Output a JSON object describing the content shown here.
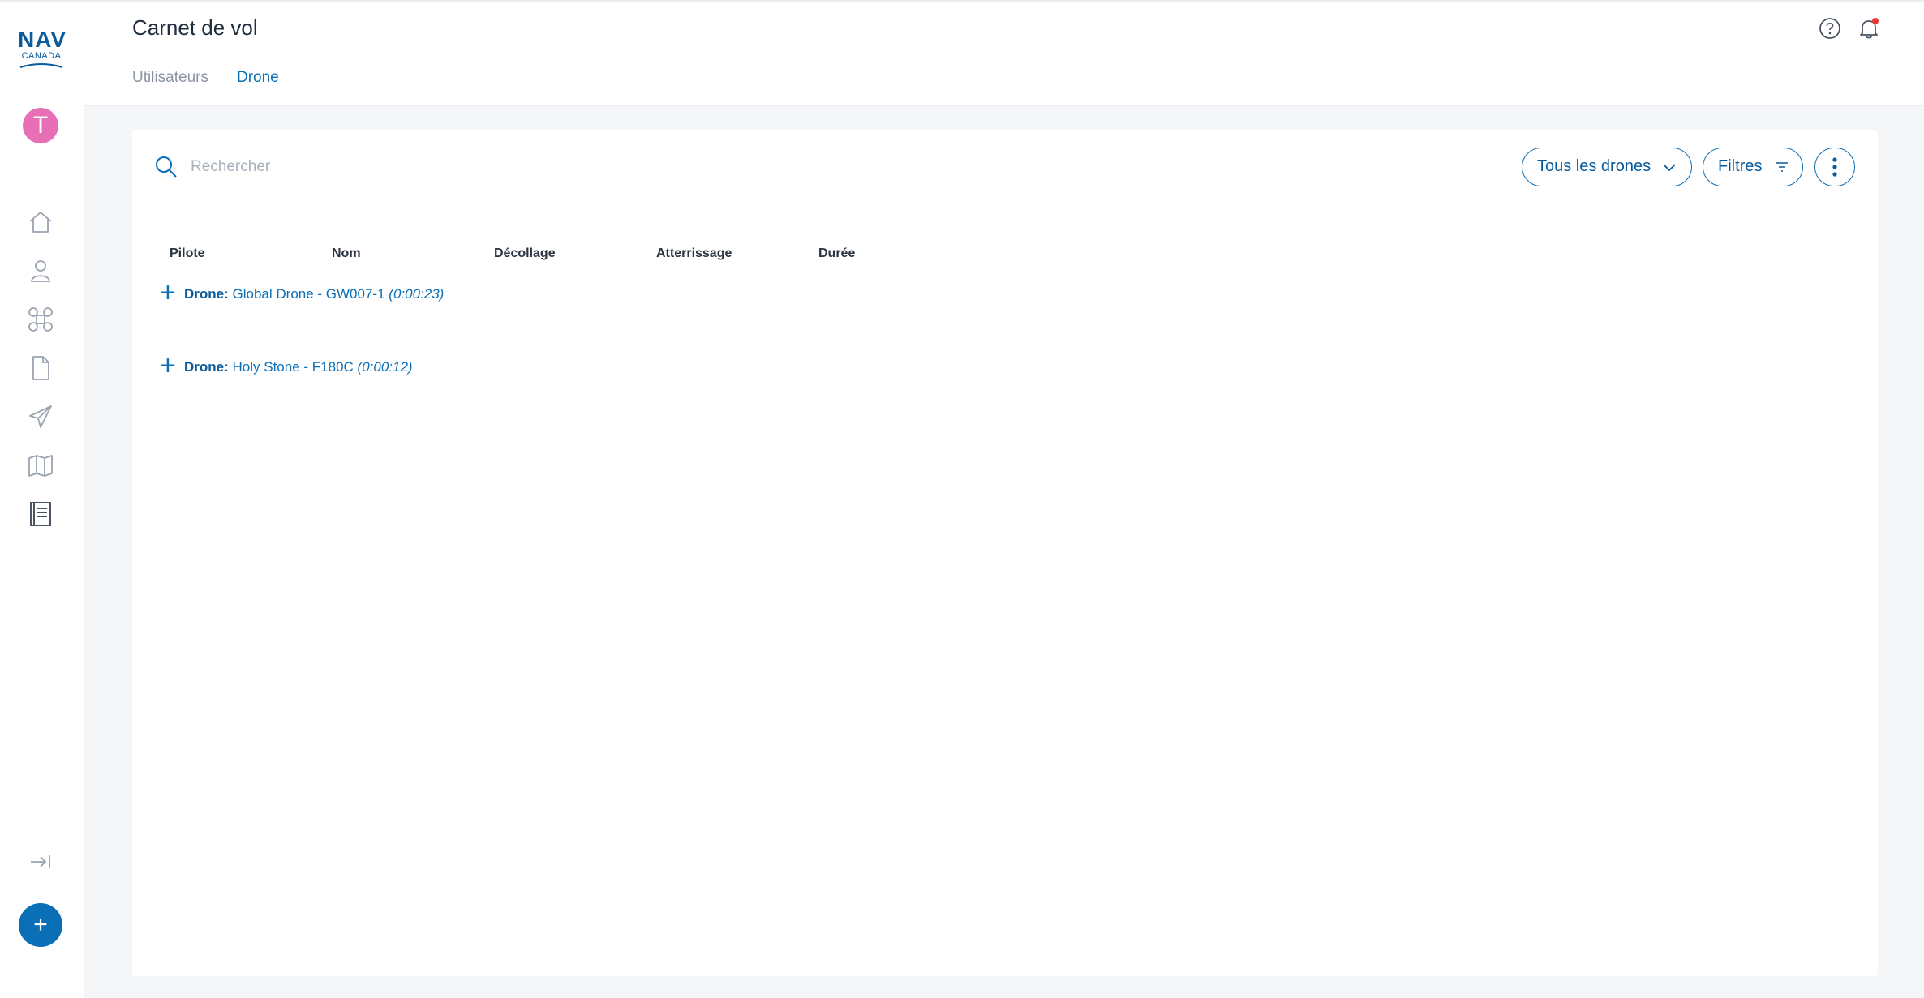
{
  "brand": {
    "logo_main": "NAV",
    "logo_sub": "CANADA"
  },
  "user": {
    "avatar_initial": "T",
    "avatar_color": "#e76fb6"
  },
  "sidebar": {
    "items": [
      {
        "icon": "home-icon"
      },
      {
        "icon": "user-icon"
      },
      {
        "icon": "drone-icon"
      },
      {
        "icon": "document-icon"
      },
      {
        "icon": "paper-plane-icon"
      },
      {
        "icon": "map-icon"
      },
      {
        "icon": "logbook-icon"
      }
    ],
    "fab_label": "+"
  },
  "header": {
    "title": "Carnet de vol",
    "tabs": [
      {
        "label": "Utilisateurs",
        "active": false
      },
      {
        "label": "Drone",
        "active": true
      }
    ]
  },
  "toolbar": {
    "search_placeholder": "Rechercher",
    "drone_filter_label": "Tous les drones",
    "filters_label": "Filtres"
  },
  "table": {
    "columns": [
      "Pilote",
      "Nom",
      "Décollage",
      "Atterrissage",
      "Durée"
    ],
    "groups": [
      {
        "label": "Drone:",
        "name": "Global Drone - GW007-1",
        "duration": "(0:00:23)"
      },
      {
        "label": "Drone:",
        "name": "Holy Stone - F180C",
        "duration": "(0:00:12)"
      }
    ]
  },
  "colors": {
    "accent": "#0a6fb6",
    "background": "#f5f6f8",
    "notification_dot": "#e53935"
  }
}
